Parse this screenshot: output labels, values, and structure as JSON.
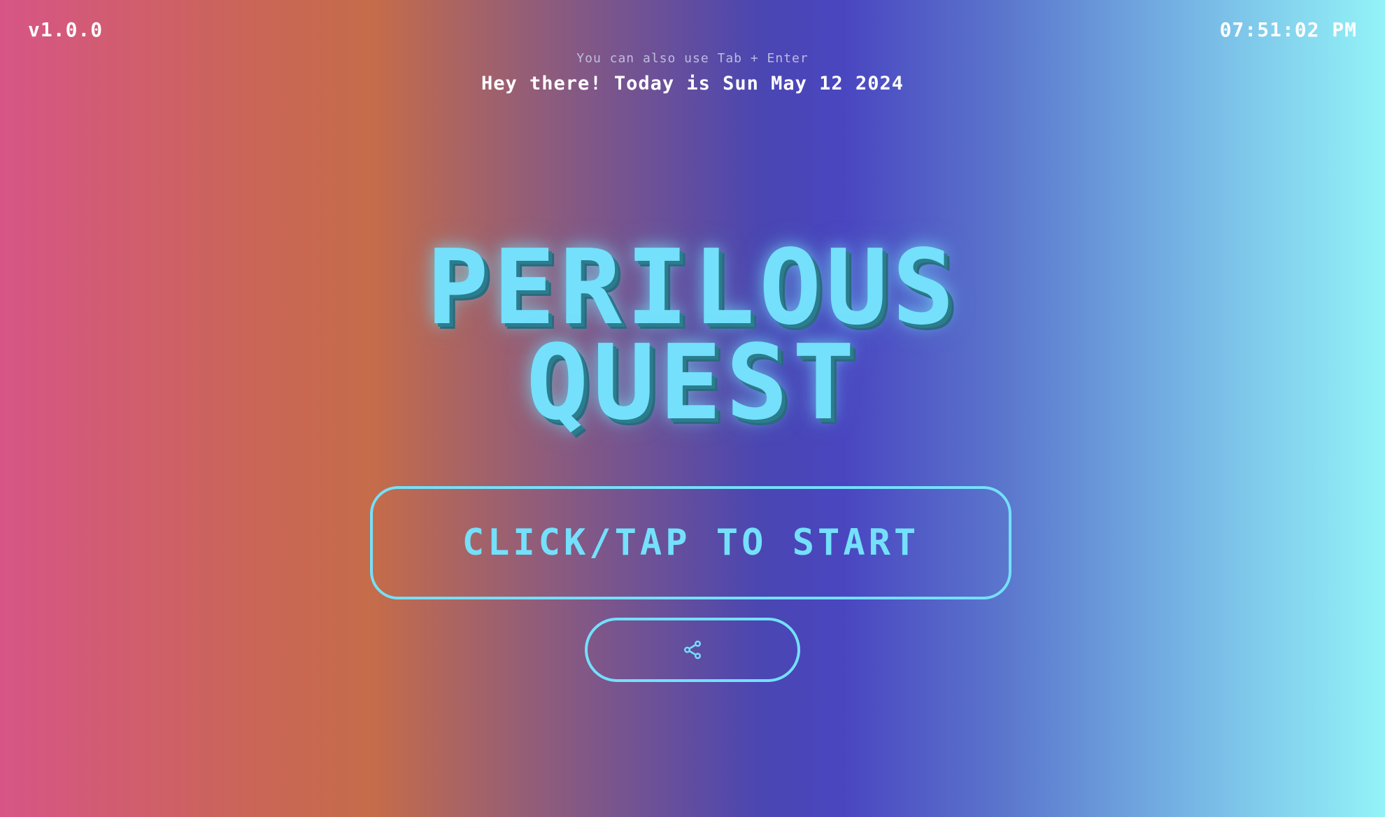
{
  "header": {
    "version": "v1.0.0",
    "clock": "07:51:02 PM",
    "hint": "You can also use Tab + Enter",
    "greeting": "Hey there! Today is Sun May 12 2024"
  },
  "title": {
    "line1": "PERILOUS",
    "line2": "QUEST"
  },
  "buttons": {
    "start_label": "CLICK/TAP TO START",
    "share_icon": "share-icon"
  },
  "colors": {
    "accent": "#74e0fb",
    "text": "#ffffff",
    "gradient": [
      "#d75586",
      "#c56c4a",
      "#4a46b2",
      "#93f3f7"
    ]
  }
}
